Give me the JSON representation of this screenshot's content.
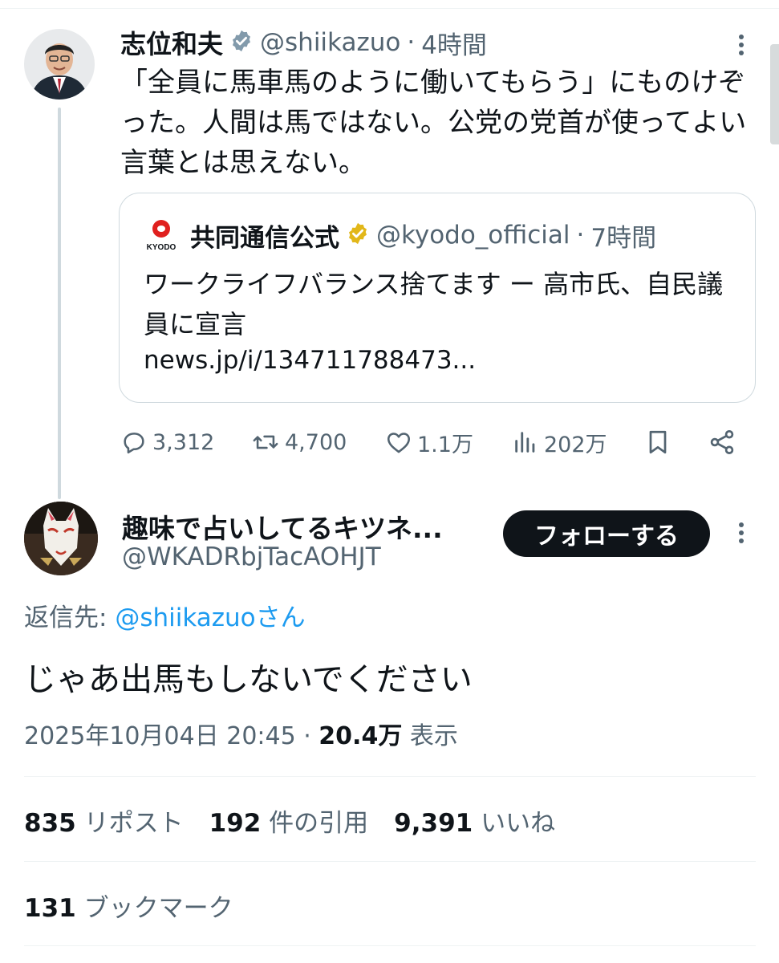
{
  "parent": {
    "author_name": "志位和夫",
    "handle": "@shiikazuo",
    "time": "4時間",
    "text": "「全員に馬車馬のように働いてもらう」にものけぞった。人間は馬ではない。公党の党首が使ってよい言葉とは思えない。",
    "quote": {
      "logo_text": "KYODO",
      "author_name": "共同通信公式",
      "handle": "@kyodo_official",
      "time": "7時間",
      "text": "ワークライフバランス捨てます ー 高市氏、自民議員に宣言",
      "link": "news.jp/i/134711788473..."
    },
    "actions": {
      "replies": "3,312",
      "reposts": "4,700",
      "likes": "1.1万",
      "views": "202万"
    }
  },
  "reply": {
    "author_name": "趣味で占いしてるキツネ...",
    "handle": "@WKADRbjTacAOHJT",
    "follow_label": "フォローする",
    "reply_to_prefix": "返信先: ",
    "reply_to_mention": "@shiikazuoさん",
    "text": "じゃあ出馬もしないでください",
    "datetime": "2025年10月04日 20:45",
    "separator": " · ",
    "views_count": "20.4万",
    "views_label": " 表示",
    "stats": {
      "reposts_num": "835",
      "reposts_label": " リポスト",
      "quotes_num": "192",
      "quotes_label": " 件の引用",
      "likes_num": "9,391",
      "likes_label": " いいね",
      "bookmarks_num": "131",
      "bookmarks_label": " ブックマーク"
    }
  },
  "colors": {
    "text": "#0f1419",
    "secondary": "#536471",
    "link": "#1d9bf0",
    "verified_gold": "#e2b719",
    "verified_gray": "#829aab",
    "border": "#cfd9de",
    "button": "#0f1419"
  }
}
